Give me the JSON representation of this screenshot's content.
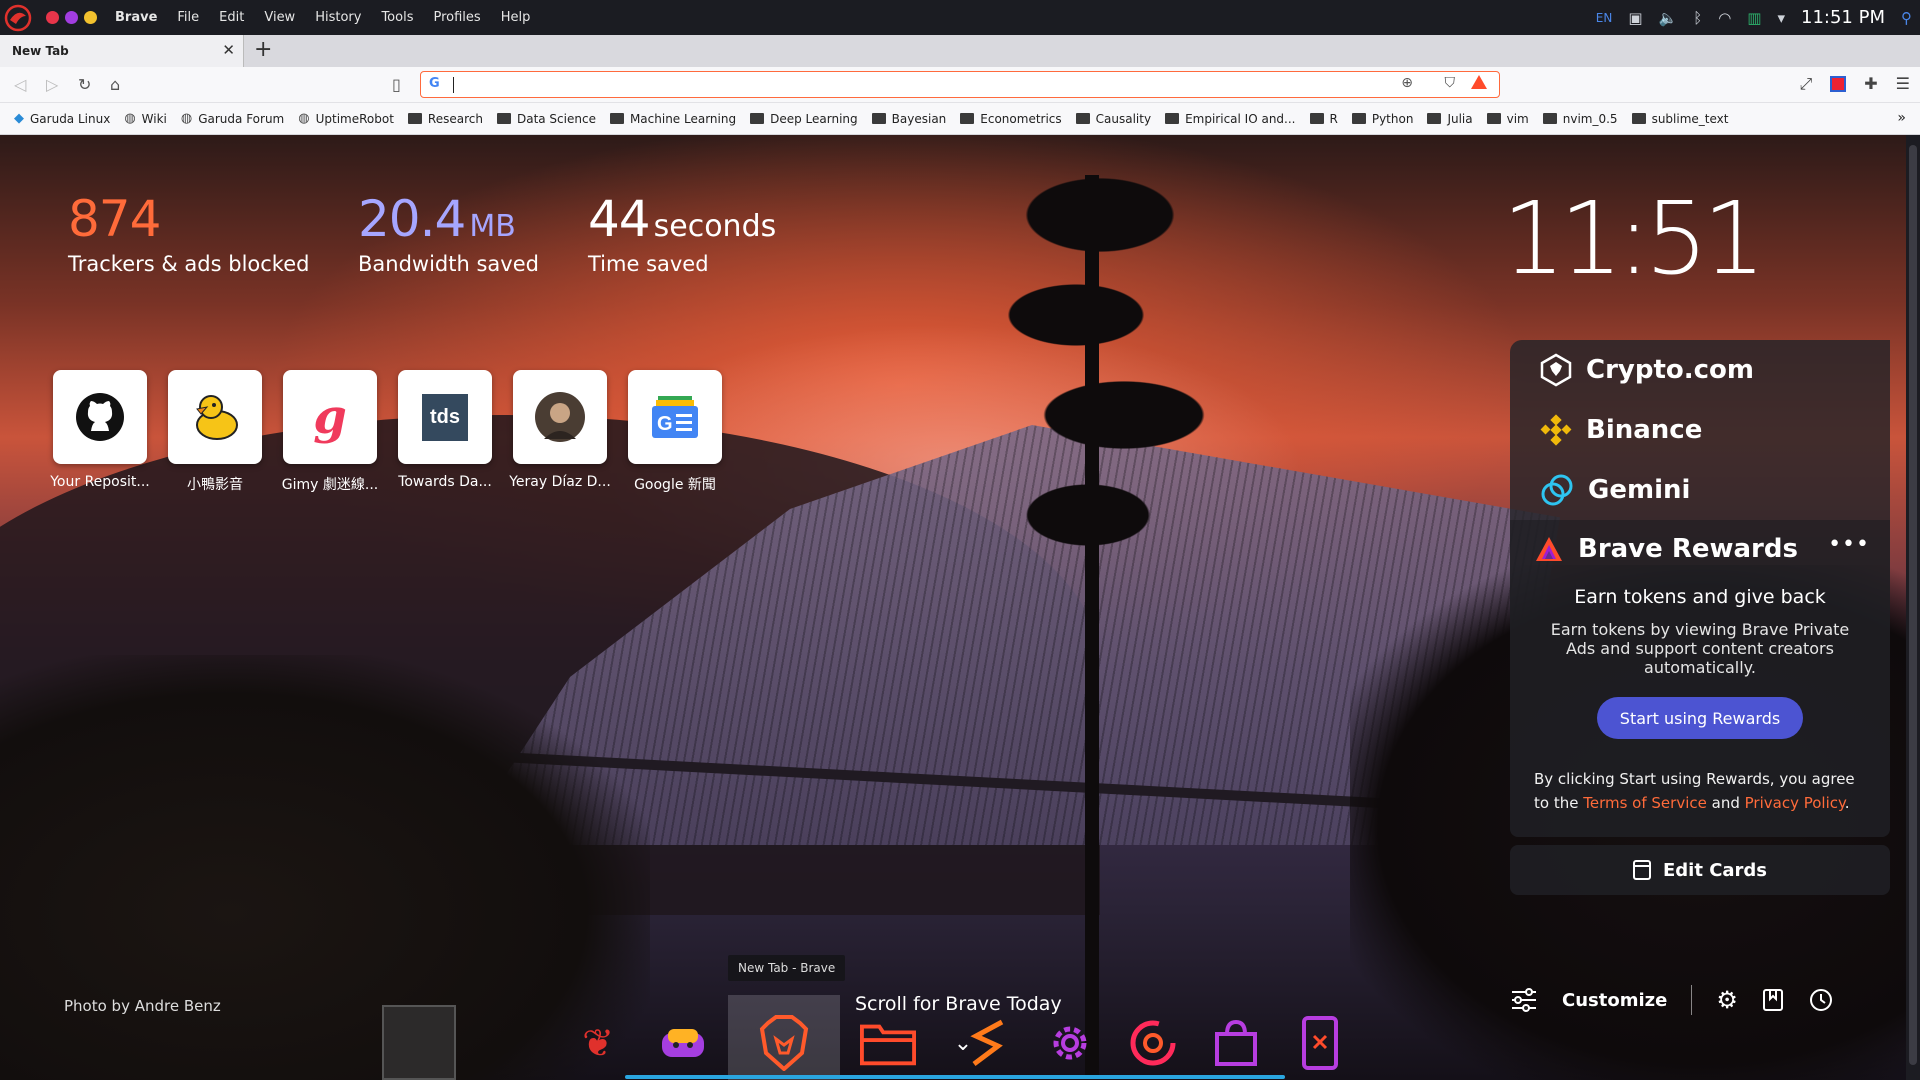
{
  "system": {
    "menus": [
      "Brave",
      "File",
      "Edit",
      "View",
      "History",
      "Tools",
      "Profiles",
      "Help"
    ],
    "lang": "EN",
    "clock": "11:51 PM"
  },
  "tab": {
    "title": "New Tab"
  },
  "bookmarks": [
    {
      "label": "Garuda Linux",
      "icon": "garuda-icon"
    },
    {
      "label": "Wiki",
      "icon": "globe-icon"
    },
    {
      "label": "Garuda Forum",
      "icon": "globe-icon"
    },
    {
      "label": "UptimeRobot",
      "icon": "globe-icon"
    },
    {
      "label": "Research",
      "icon": "folder-icon"
    },
    {
      "label": "Data Science",
      "icon": "folder-icon"
    },
    {
      "label": "Machine Learning",
      "icon": "folder-icon"
    },
    {
      "label": "Deep Learning",
      "icon": "folder-icon"
    },
    {
      "label": "Bayesian",
      "icon": "folder-icon"
    },
    {
      "label": "Econometrics",
      "icon": "folder-icon"
    },
    {
      "label": "Causality",
      "icon": "folder-icon"
    },
    {
      "label": "Empirical IO and...",
      "icon": "folder-icon"
    },
    {
      "label": "R",
      "icon": "folder-icon"
    },
    {
      "label": "Python",
      "icon": "folder-icon"
    },
    {
      "label": "Julia",
      "icon": "folder-icon"
    },
    {
      "label": "vim",
      "icon": "folder-icon"
    },
    {
      "label": "nvim_0.5",
      "icon": "folder-icon"
    },
    {
      "label": "sublime_text",
      "icon": "folder-icon"
    }
  ],
  "search": {
    "placeholder": "",
    "value": ""
  },
  "stats": {
    "trackers": {
      "value": "874",
      "label": "Trackers & ads blocked"
    },
    "bandwidth": {
      "value": "20.4",
      "unit": "MB",
      "label": "Bandwidth saved"
    },
    "time": {
      "value": "44",
      "unit": "seconds",
      "label": "Time saved"
    }
  },
  "top_sites": [
    {
      "name": "Your Reposit...",
      "icon": "github-icon"
    },
    {
      "name": "小鴨影音",
      "icon": "duck-icon"
    },
    {
      "name": "Gimy 劇迷線...",
      "icon": "gimy-icon"
    },
    {
      "name": "Towards Da...",
      "icon": "tds-icon",
      "tile_text": "tds"
    },
    {
      "name": "Yeray Díaz D...",
      "icon": "avatar-icon"
    },
    {
      "name": "Google 新聞",
      "icon": "google-news-icon"
    }
  ],
  "clock": "11:51",
  "cards": {
    "crypto": [
      {
        "name": "Crypto.com",
        "icon": "crypto-com-icon"
      },
      {
        "name": "Binance",
        "icon": "binance-icon",
        "color": "#f0b90b"
      },
      {
        "name": "Gemini",
        "icon": "gemini-icon",
        "color": "#2ec4f0"
      }
    ],
    "rewards": {
      "title": "Brave Rewards",
      "subtitle": "Earn tokens and give back",
      "description": "Earn tokens by viewing Brave Private Ads and support content creators automatically.",
      "button": "Start using Rewards",
      "legal_prefix": "By clicking Start using Rewards, you agree to the",
      "terms": "Terms of Service",
      "and": "and",
      "privacy": "Privacy Policy",
      "period": "."
    },
    "edit": "Edit Cards"
  },
  "footer": {
    "credit": "Photo by Andre Benz",
    "scroll_hint": "Scroll for Brave Today",
    "customize": "Customize"
  },
  "dock": {
    "tooltip": "New Tab - Brave",
    "apps": [
      "garuda-icon",
      "gamer-icon",
      "brave-icon",
      "folder-icon",
      "sublime-icon",
      "settings-icon",
      "octopi-icon",
      "store-icon",
      "kde-connect-icon"
    ]
  },
  "colors": {
    "accent": "#ff6b3a",
    "rewards_button": "#4c54d2",
    "trackers": "#ff6b3a",
    "bandwidth": "#a6a6ff"
  }
}
